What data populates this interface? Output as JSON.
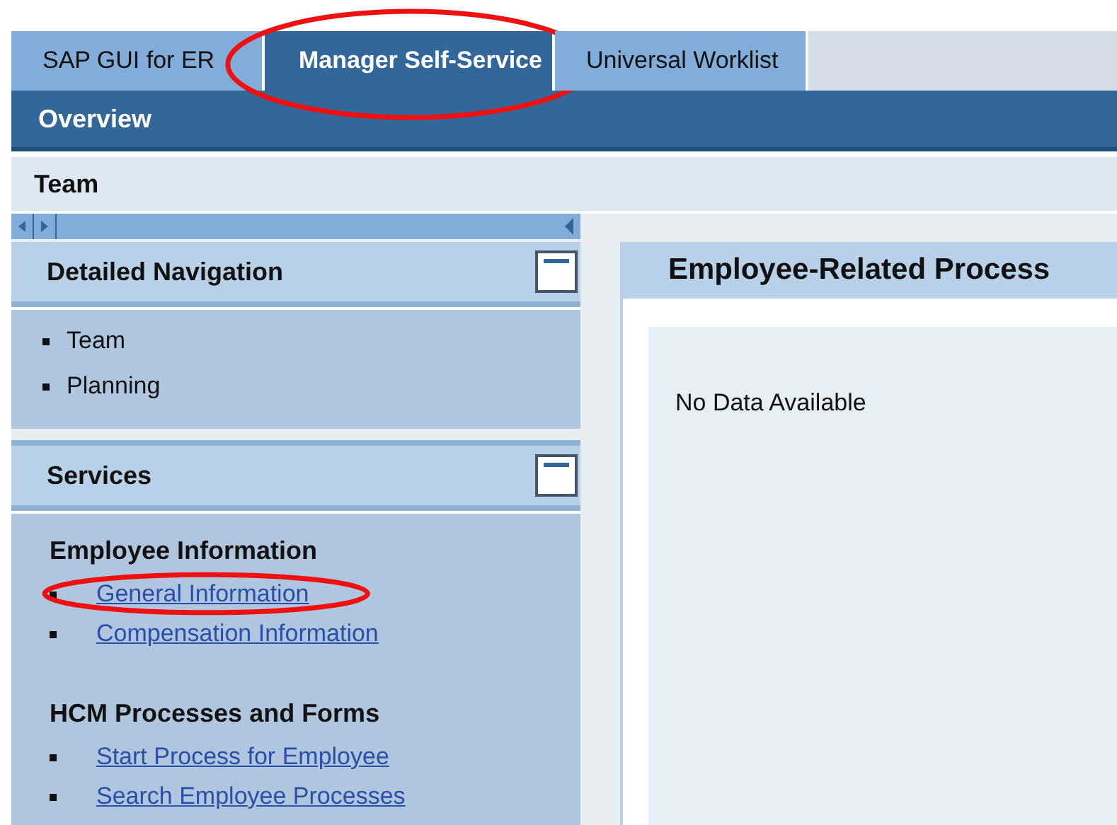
{
  "tabs": [
    {
      "label": "SAP GUI for ER",
      "selected": false,
      "circled": false
    },
    {
      "label": "Manager Self-Service",
      "selected": true,
      "circled": true
    },
    {
      "label": "Universal Worklist",
      "selected": false,
      "circled": false
    }
  ],
  "subnav": {
    "label": "Overview"
  },
  "page_title": "Team",
  "detailed_navigation": {
    "title": "Detailed Navigation",
    "items": [
      "Team",
      "Planning"
    ]
  },
  "services": {
    "title": "Services",
    "groups": [
      {
        "heading": "Employee Information",
        "links": [
          {
            "label": "General Information",
            "circled": true
          },
          {
            "label": "Compensation Information",
            "circled": false
          }
        ]
      },
      {
        "heading": "HCM Processes and Forms",
        "links": [
          {
            "label": "Start Process for Employee",
            "circled": false
          },
          {
            "label": "Search Employee Processes",
            "circled": false
          }
        ]
      }
    ]
  },
  "panel": {
    "title": "Employee-Related Process",
    "message": "No Data Available"
  }
}
